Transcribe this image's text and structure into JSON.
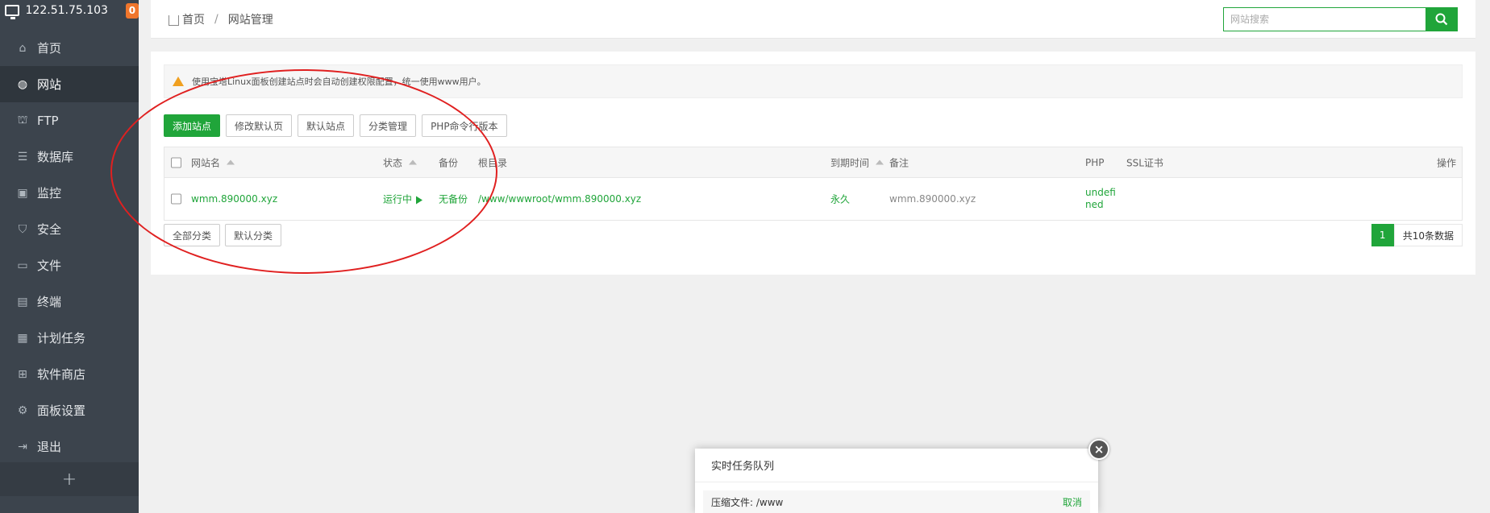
{
  "sidebar": {
    "ip": "122.51.75.103",
    "badge": "0",
    "items": [
      {
        "label": "首页",
        "icon": "home-icon",
        "glyph": "⌂"
      },
      {
        "label": "网站",
        "icon": "globe-icon",
        "glyph": "◍"
      },
      {
        "label": "FTP",
        "icon": "ftp-icon",
        "glyph": "⛫"
      },
      {
        "label": "数据库",
        "icon": "database-icon",
        "glyph": "☰"
      },
      {
        "label": "监控",
        "icon": "monitor-icon",
        "glyph": "▣"
      },
      {
        "label": "安全",
        "icon": "shield-icon",
        "glyph": "⛉"
      },
      {
        "label": "文件",
        "icon": "folder-icon",
        "glyph": "▭"
      },
      {
        "label": "终端",
        "icon": "terminal-icon",
        "glyph": "▤"
      },
      {
        "label": "计划任务",
        "icon": "calendar-icon",
        "glyph": "▦"
      },
      {
        "label": "软件商店",
        "icon": "apps-icon",
        "glyph": "⊞"
      },
      {
        "label": "面板设置",
        "icon": "gear-icon",
        "glyph": "⚙"
      },
      {
        "label": "退出",
        "icon": "logout-icon",
        "glyph": "⇥"
      }
    ],
    "active_index": 1,
    "add_label": "+"
  },
  "breadcrumb": {
    "home": "首页",
    "separator": "/",
    "current": "网站管理"
  },
  "search": {
    "placeholder": "网站搜索"
  },
  "alert": {
    "text": "使用宝塔Linux面板创建站点时会自动创建权限配置，统一使用www用户。"
  },
  "toolbar": {
    "buttons": [
      "添加站点",
      "修改默认页",
      "默认站点",
      "分类管理",
      "PHP命令行版本"
    ]
  },
  "table": {
    "headers": {
      "name": "网站名",
      "status": "状态",
      "backup": "备份",
      "root": "根目录",
      "expire": "到期时间",
      "remark": "备注",
      "php": "PHP",
      "ssl": "SSL证书",
      "ops": "操作"
    },
    "rows": [
      {
        "name": "wmm.890000.xyz",
        "status": "运行中",
        "backup": "无备份",
        "root": "/www/wwwroot/wmm.890000.xyz",
        "expire": "永久",
        "remark": "wmm.890000.xyz",
        "php_line1": "undefi",
        "php_line2": "ned",
        "ssl": ""
      }
    ]
  },
  "categories": [
    "全部分类",
    "默认分类"
  ],
  "pagination": {
    "page": "1",
    "total": "共10条数据"
  },
  "popup": {
    "title": "实时任务队列",
    "task": "压缩文件: /www",
    "cancel": "取消",
    "close": "×"
  },
  "colors": {
    "accent": "#20a53a",
    "sidebar": "#3c444d",
    "annotation": "#e02020"
  }
}
